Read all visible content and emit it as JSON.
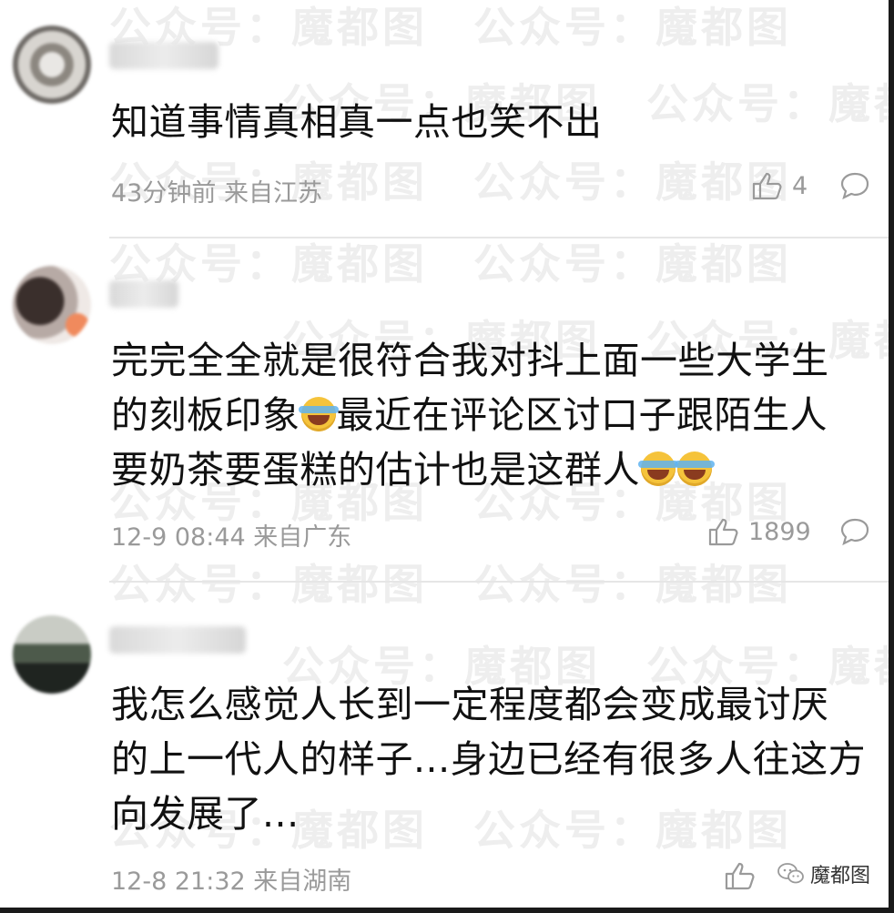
{
  "watermark_text": "公众号：魔都图",
  "comments": [
    {
      "text_lines": [
        "知道事情真相真一点也笑不出"
      ],
      "time": "43分钟前",
      "location": "来自江苏",
      "likes": "4"
    },
    {
      "text_lines": [
        "完完全全就是很符合我对抖上面一些大学生",
        "的刻板印象",
        "最近在评论区讨口子跟陌生人",
        "要奶茶要蛋糕的估计也是这群人"
      ],
      "time": "12-9 08:44",
      "location": "来自广东",
      "likes": "1899"
    },
    {
      "text_lines": [
        "我怎么感觉人长到一定程度都会变成最讨厌",
        "的上一代人的样子...身边已经有很多人往这方",
        "向发展了..."
      ],
      "time": "12-8 21:32",
      "location": "来自湖南",
      "likes": ""
    }
  ],
  "brand": {
    "name": "魔都图",
    "icon": "wechat-icon"
  },
  "icons": {
    "like": "thumbs-up-icon",
    "reply": "comment-bubble-icon"
  }
}
